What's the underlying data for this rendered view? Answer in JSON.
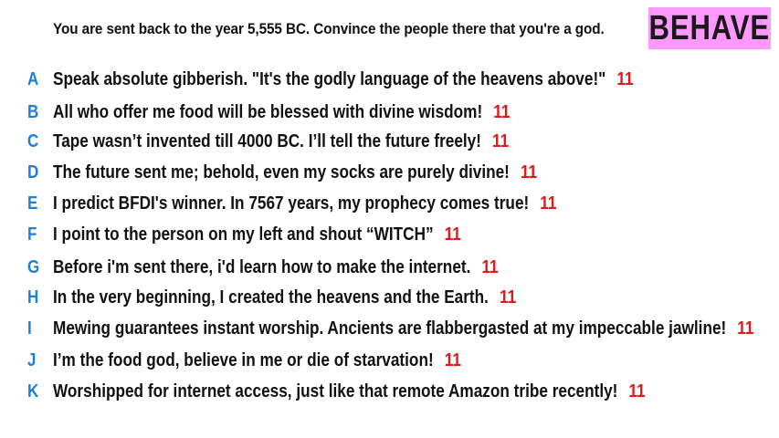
{
  "prompt": "You are sent back to the year 5,555 BC. Convince the people there that you're a god.",
  "badge": "BEHAVE",
  "colors": {
    "letter": "#1f7fd6",
    "score": "#e01818",
    "badge_bg": "#ff99ff"
  },
  "answers": [
    {
      "letter": "A",
      "text": "Speak absolute gibberish. \"It's the godly language of the heavens above!\"",
      "score": "11"
    },
    {
      "letter": "B",
      "text": "All who offer me food will be blessed with divine wisdom!",
      "score": "11"
    },
    {
      "letter": "C",
      "text": "Tape wasn’t invented till 4000 BC. I’ll tell the future freely!",
      "score": "11"
    },
    {
      "letter": "D",
      "text": "The future sent me; behold, even my socks are purely divine!",
      "score": "11"
    },
    {
      "letter": "E",
      "text": "I predict BFDI's winner. In 7567 years, my prophecy comes true!",
      "score": "11"
    },
    {
      "letter": "F",
      "text": "I point to the person on my left and shout “WITCH”",
      "score": "11"
    },
    {
      "letter": "G",
      "text": "Before i'm sent there, i'd learn how to make the internet.",
      "score": "11"
    },
    {
      "letter": "H",
      "text": "In the very beginning, I created the heavens and the Earth.",
      "score": "11"
    },
    {
      "letter": "I",
      "text": "Mewing guarantees instant worship. Ancients are flabbergasted at my impeccable jawline!",
      "score": "11"
    },
    {
      "letter": "J",
      "text": "I’m the food god, believe in me or die of starvation!",
      "score": "11"
    },
    {
      "letter": "K",
      "text": "Worshipped for internet access, just like that remote Amazon tribe recently!",
      "score": "11"
    }
  ]
}
